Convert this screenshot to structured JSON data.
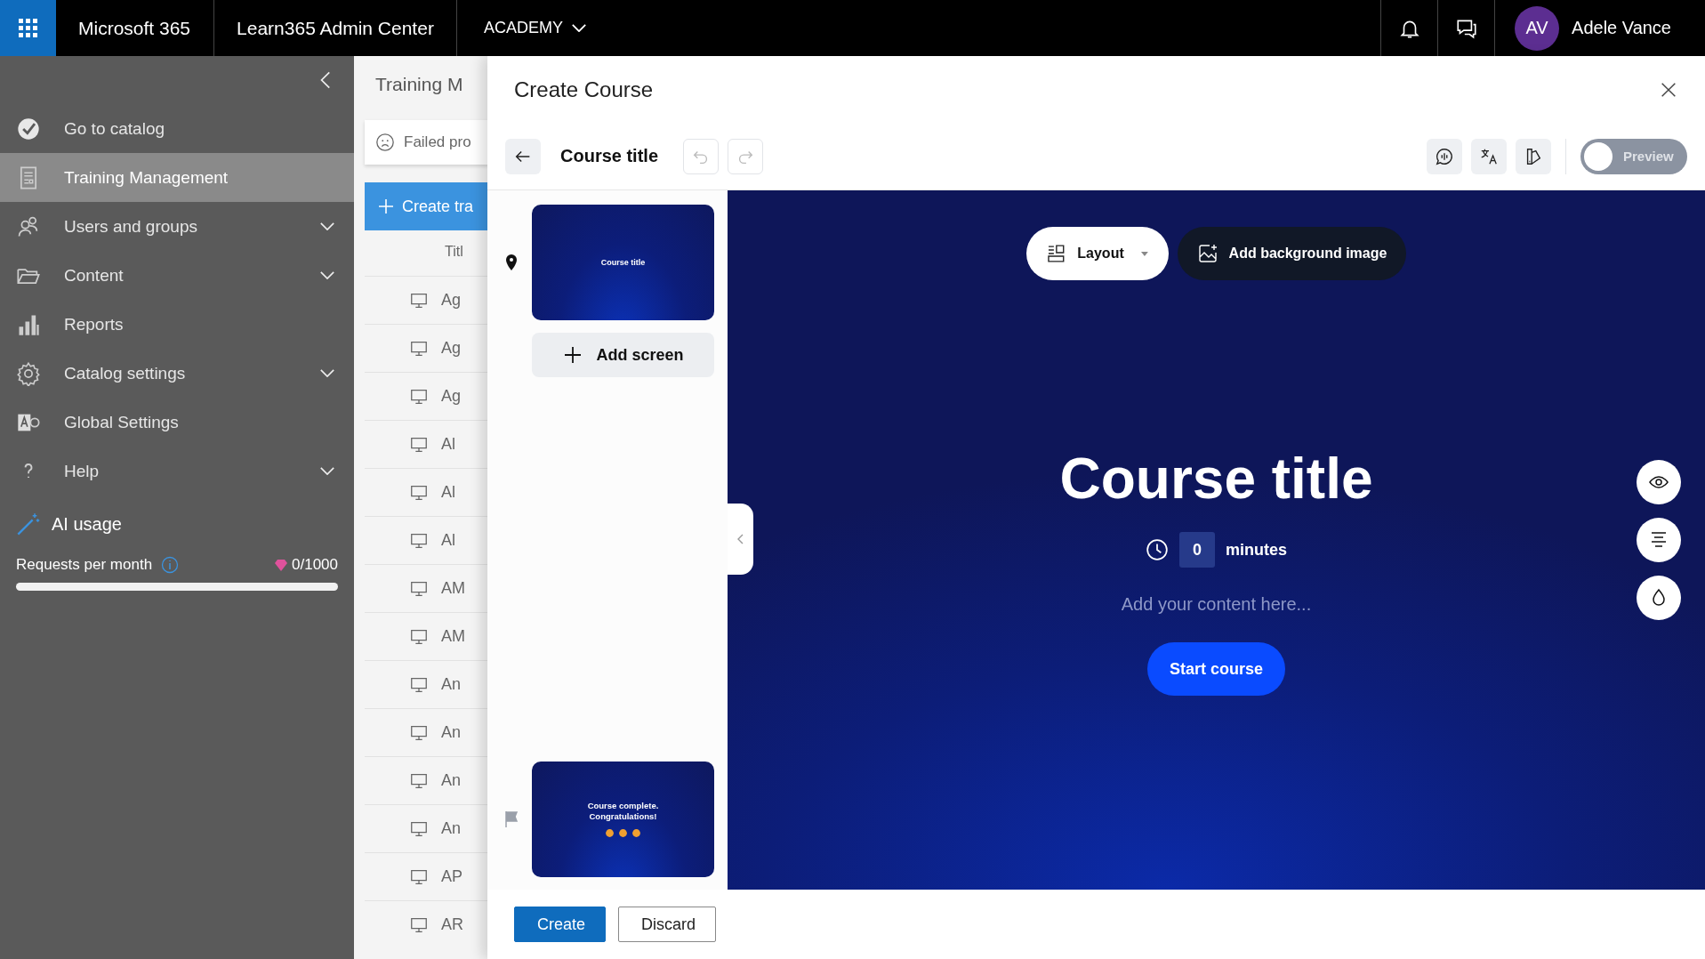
{
  "top_bar": {
    "app_name": "Microsoft 365",
    "product": "Learn365 Admin Center",
    "tenant": "ACADEMY",
    "user": {
      "initials": "AV",
      "name": "Adele Vance"
    }
  },
  "sidebar": {
    "items": [
      {
        "label": "Go to catalog",
        "expandable": false,
        "selected": false
      },
      {
        "label": "Training Management",
        "expandable": false,
        "selected": true
      },
      {
        "label": "Users and groups",
        "expandable": true,
        "selected": false
      },
      {
        "label": "Content",
        "expandable": true,
        "selected": false
      },
      {
        "label": "Reports",
        "expandable": false,
        "selected": false
      },
      {
        "label": "Catalog settings",
        "expandable": true,
        "selected": false
      },
      {
        "label": "Global Settings",
        "expandable": false,
        "selected": false
      },
      {
        "label": "Help",
        "expandable": true,
        "selected": false
      }
    ],
    "ai_usage": {
      "title": "AI usage",
      "label": "Requests per month",
      "count": "0/1000",
      "level": 0
    }
  },
  "background_page": {
    "title": "Training M",
    "alert": "Failed pro",
    "create_button": "Create tra",
    "column_header": "Titl",
    "rows": [
      "Ag",
      "Ag",
      "Ag",
      "Al",
      "Al",
      "Al",
      "AM",
      "AM",
      "An",
      "An",
      "An",
      "An",
      "AP",
      "AR"
    ]
  },
  "dialog": {
    "title": "Create Course",
    "course_title": "Course title",
    "preview": {
      "label": "Preview",
      "on": false
    },
    "screens": [
      {
        "kind": "start",
        "title": "Course title"
      },
      {
        "kind": "end",
        "title": "Course complete. Congratulations!"
      }
    ],
    "add_screen": "Add screen",
    "canvas": {
      "layout_button": "Layout",
      "background_button": "Add background image",
      "title": "Course title",
      "duration": "0",
      "duration_unit": "minutes",
      "content_placeholder": "Add your content here...",
      "start_button": "Start course"
    },
    "buttons": [
      "Create",
      "Discard"
    ]
  }
}
